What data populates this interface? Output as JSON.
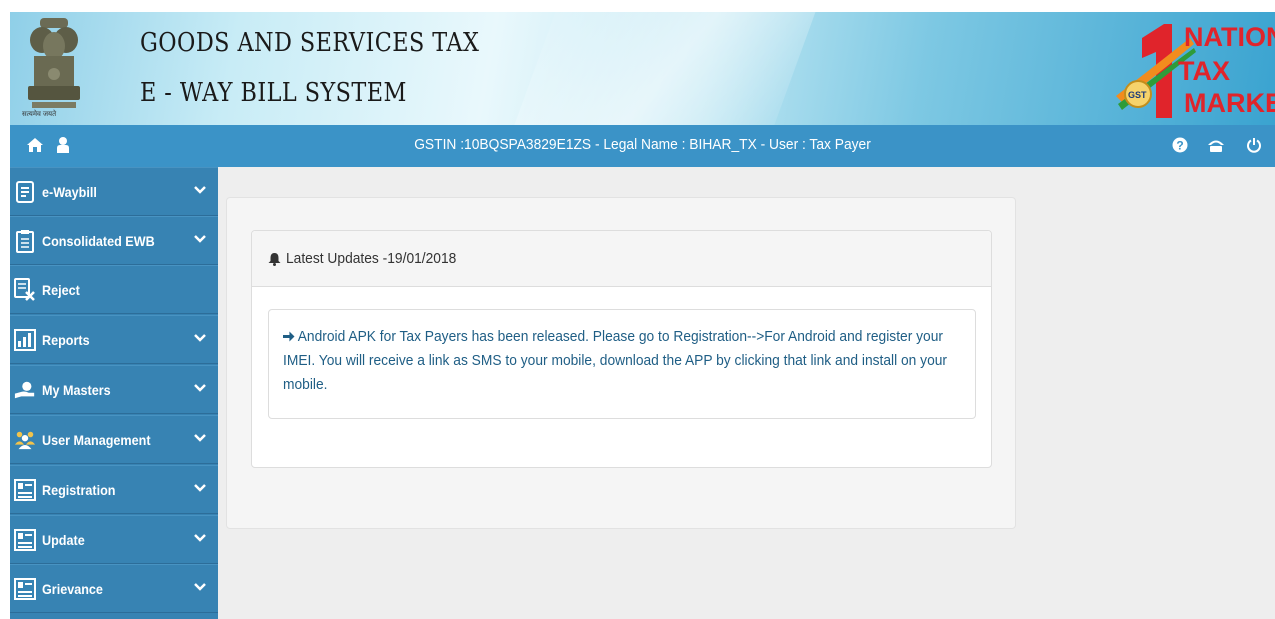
{
  "header": {
    "title_line1": "GOODS AND SERVICES TAX",
    "title_line2": "E - WAY BILL SYSTEM",
    "emblem_caption": "सत्यमेव जयते",
    "brand_logo": {
      "line1": "NATION",
      "line2": "TAX",
      "line3": "MARKET",
      "badge": "GST",
      "brand_color": "#e0242b"
    }
  },
  "topbar": {
    "gstin_info": "GSTIN :10BQSPA3829E1ZS - Legal Name : BIHAR_TX - User : Tax Payer",
    "left_icons": [
      "home-icon",
      "user-icon"
    ],
    "right_icons": [
      "help-icon",
      "change-password-icon",
      "power-icon"
    ],
    "color": "#3b93c7"
  },
  "sidebar": {
    "color": "#3783b3",
    "items": [
      {
        "label": "e-Waybill",
        "icon": "document-icon",
        "has_submenu": true
      },
      {
        "label": "Consolidated EWB",
        "icon": "clipboard-icon",
        "has_submenu": true
      },
      {
        "label": "Reject",
        "icon": "reject-document-icon",
        "has_submenu": false
      },
      {
        "label": "Reports",
        "icon": "report-chart-icon",
        "has_submenu": true
      },
      {
        "label": "My Masters",
        "icon": "masters-hand-icon",
        "has_submenu": true
      },
      {
        "label": "User Management",
        "icon": "users-group-icon",
        "has_submenu": true
      },
      {
        "label": "Registration",
        "icon": "form-icon",
        "has_submenu": true
      },
      {
        "label": "Update",
        "icon": "form-icon",
        "has_submenu": true
      },
      {
        "label": "Grievance",
        "icon": "form-icon",
        "has_submenu": true
      }
    ]
  },
  "main": {
    "updates": {
      "heading": "Latest Updates -19/01/2018",
      "items": [
        {
          "text": "Android APK for Tax Payers has been released. Please go to Registration-->For Android and register your IMEI. You will receive a link as SMS to your mobile, download the APP by clicking that link and install on your mobile."
        }
      ]
    }
  }
}
